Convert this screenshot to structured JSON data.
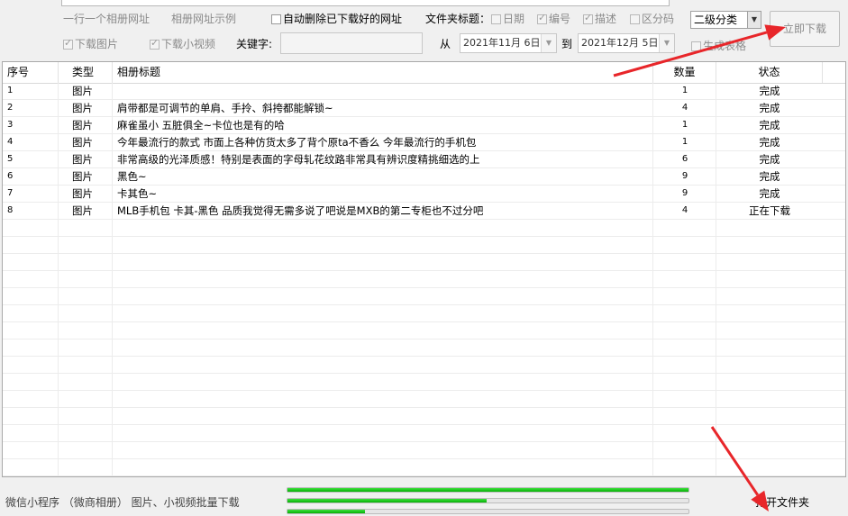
{
  "top": {
    "option_one_per_line": "一行一个相册网址",
    "option_example": "相册网址示例",
    "auto_delete_label": "自动删除已下载好的网址",
    "folder_title_label": "文件夹标题：",
    "folder_opts": [
      {
        "label": "日期",
        "checked": false
      },
      {
        "label": "编号",
        "checked": true
      },
      {
        "label": "描述",
        "checked": true
      },
      {
        "label": "区分码",
        "checked": false
      }
    ],
    "category_select": "二级分类",
    "download_now": "立即下载",
    "download_images": "下载图片",
    "download_videos": "下载小视频",
    "keyword_label": "关键字:",
    "keyword_value": "",
    "from_label": "从",
    "from_date": "2021年11月 6日",
    "to_label": "到",
    "to_date": "2021年12月 5日",
    "generate_table": "生成表格"
  },
  "table": {
    "headers": [
      "序号",
      "类型",
      "相册标题",
      "数量",
      "状态"
    ],
    "rows": [
      {
        "id": "1",
        "type": "图片",
        "title": "",
        "count": "1",
        "status": "完成"
      },
      {
        "id": "2",
        "type": "图片",
        "title": "肩带都是可调节的单肩、手拎、斜挎都能解锁~",
        "count": "4",
        "status": "完成"
      },
      {
        "id": "3",
        "type": "图片",
        "title": "麻雀虽小 五脏俱全~卡位也是有的哈",
        "count": "1",
        "status": "完成"
      },
      {
        "id": "4",
        "type": "图片",
        "title": "今年最流行的款式 市面上各种仿货太多了背个原ta不香么 今年最流行的手机包",
        "count": "1",
        "status": "完成"
      },
      {
        "id": "5",
        "type": "图片",
        "title": "非常高级的光泽质感！特别是表面的字母轧花纹路非常具有辨识度精挑细选的上",
        "count": "6",
        "status": "完成"
      },
      {
        "id": "6",
        "type": "图片",
        "title": "黑色~",
        "count": "9",
        "status": "完成"
      },
      {
        "id": "7",
        "type": "图片",
        "title": "卡其色~",
        "count": "9",
        "status": "完成"
      },
      {
        "id": "8",
        "type": "图片",
        "title": "MLB手机包 卡其-黑色 品质我觉得无需多说了吧说是MXB的第二专柜也不过分吧",
        "count": "4",
        "status": "正在下载"
      }
    ]
  },
  "bottom": {
    "footer_text": "微信小程序 （微商相册） 图片、小视频批量下载",
    "open_folder": "打开文件夹",
    "progress": [
      1.0,
      0.497,
      0.193
    ]
  },
  "colors": {
    "arrow": "#e8262a",
    "progress": "#17c417"
  }
}
